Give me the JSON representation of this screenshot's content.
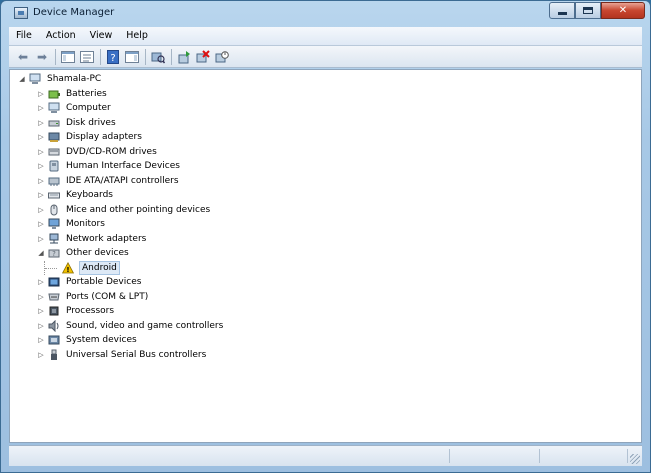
{
  "window": {
    "title": "Device Manager"
  },
  "menu": {
    "items": [
      "File",
      "Action",
      "View",
      "Help"
    ]
  },
  "toolbar": {
    "buttons": [
      "back-icon",
      "forward-icon",
      "show-hide-console-tree-icon",
      "properties-pane-icon",
      "help-icon",
      "action-pane-icon",
      "scan-hardware-icon",
      "update-driver-icon",
      "uninstall-icon",
      "disable-icon"
    ]
  },
  "tree": {
    "root": "Shamala-PC",
    "items": [
      {
        "label": "Batteries",
        "icon": "battery-icon",
        "expanded": false
      },
      {
        "label": "Computer",
        "icon": "computer-icon",
        "expanded": false
      },
      {
        "label": "Disk drives",
        "icon": "disk-drive-icon",
        "expanded": false
      },
      {
        "label": "Display adapters",
        "icon": "display-adapter-icon",
        "expanded": false
      },
      {
        "label": "DVD/CD-ROM drives",
        "icon": "dvd-drive-icon",
        "expanded": false
      },
      {
        "label": "Human Interface Devices",
        "icon": "hid-icon",
        "expanded": false
      },
      {
        "label": "IDE ATA/ATAPI controllers",
        "icon": "ide-controller-icon",
        "expanded": false
      },
      {
        "label": "Keyboards",
        "icon": "keyboard-icon",
        "expanded": false
      },
      {
        "label": "Mice and other pointing devices",
        "icon": "mouse-icon",
        "expanded": false
      },
      {
        "label": "Monitors",
        "icon": "monitor-icon",
        "expanded": false
      },
      {
        "label": "Network adapters",
        "icon": "network-adapter-icon",
        "expanded": false
      },
      {
        "label": "Other devices",
        "icon": "other-devices-icon",
        "expanded": true
      },
      {
        "label": "Android",
        "icon": "warning-icon",
        "child": true
      },
      {
        "label": "Portable Devices",
        "icon": "portable-device-icon",
        "expanded": false
      },
      {
        "label": "Ports (COM & LPT)",
        "icon": "port-icon",
        "expanded": false
      },
      {
        "label": "Processors",
        "icon": "processor-icon",
        "expanded": false
      },
      {
        "label": "Sound, video and game controllers",
        "icon": "sound-icon",
        "expanded": false
      },
      {
        "label": "System devices",
        "icon": "system-device-icon",
        "expanded": false
      },
      {
        "label": "Universal Serial Bus controllers",
        "icon": "usb-icon",
        "expanded": false
      }
    ]
  },
  "colors": {
    "titlebar": "#b9d6ee",
    "close_button": "#c8462f",
    "selection": "#dde9f6",
    "warning": "#f2c200"
  }
}
